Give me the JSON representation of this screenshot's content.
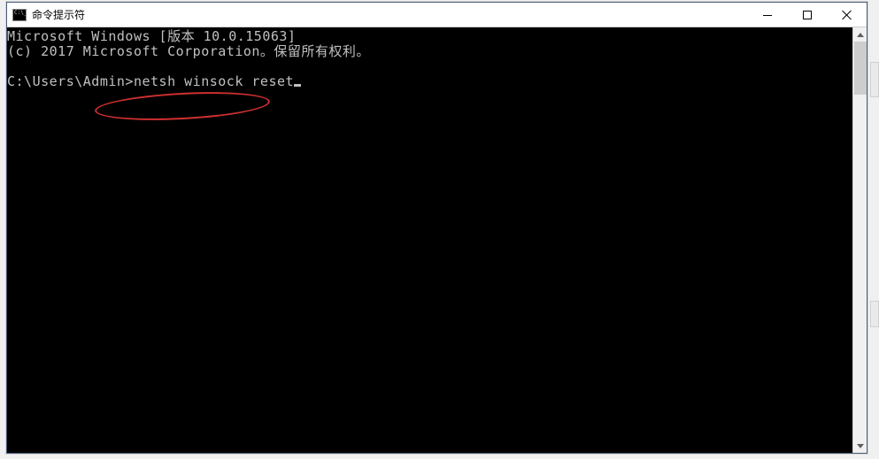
{
  "window": {
    "title": "命令提示符"
  },
  "terminal": {
    "line1": "Microsoft Windows [版本 10.0.15063]",
    "line2": "(c) 2017 Microsoft Corporation。保留所有权利。",
    "prompt": "C:\\Users\\Admin>",
    "command": "netsh winsock reset"
  }
}
